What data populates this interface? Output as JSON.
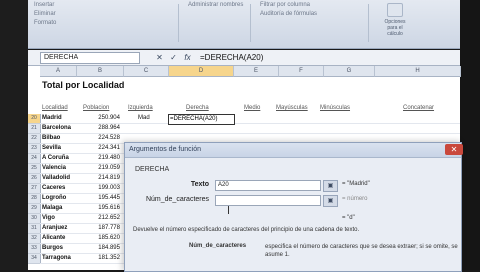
{
  "ribbon": {
    "top_items": [
      "Insertar",
      "Eliminar",
      "Formato"
    ],
    "filter_label": "Filtrar por columna",
    "manage_label": "Administrar nombres",
    "audit_label": "Auditoría de fórmulas",
    "calc_label": "Opciones para el cálculo"
  },
  "formula_bar": {
    "name_box": "DERECHA",
    "cancel_icon": "✕",
    "enter_icon": "✓",
    "fx_icon": "fx",
    "formula": "=DERECHA(A20)"
  },
  "sheet": {
    "columns": [
      "A",
      "B",
      "C",
      "D",
      "E",
      "F",
      "G",
      "H"
    ],
    "title": "Total por Localidad",
    "headers": [
      "Localidad",
      "Poblacion",
      "Izquierda",
      "Derecha",
      "Medio",
      "Mayúsculas",
      "Minúsculas",
      "Concatenar"
    ],
    "rows": [
      {
        "row": "20",
        "loc": "Madrid",
        "pob": "250.904",
        "izq": "Mad",
        "der": "=DERECHA(A20)"
      },
      {
        "row": "21",
        "loc": "Barcelona",
        "pob": "288.964",
        "izq": "",
        "der": ""
      },
      {
        "row": "22",
        "loc": "Bilbao",
        "pob": "224.528",
        "izq": "",
        "der": ""
      },
      {
        "row": "23",
        "loc": "Sevilla",
        "pob": "224.341",
        "izq": "",
        "der": ""
      },
      {
        "row": "24",
        "loc": "A Coruña",
        "pob": "219.480",
        "izq": "",
        "der": ""
      },
      {
        "row": "25",
        "loc": "Valencia",
        "pob": "219.059",
        "izq": "",
        "der": ""
      },
      {
        "row": "26",
        "loc": "Valladolid",
        "pob": "214.819",
        "izq": "",
        "der": ""
      },
      {
        "row": "27",
        "loc": "Caceres",
        "pob": "199.003",
        "izq": "",
        "der": ""
      },
      {
        "row": "28",
        "loc": "Logroño",
        "pob": "195.445",
        "izq": "",
        "der": ""
      },
      {
        "row": "29",
        "loc": "Malaga",
        "pob": "195.616",
        "izq": "",
        "der": ""
      },
      {
        "row": "30",
        "loc": "Vigo",
        "pob": "212.652",
        "izq": "",
        "der": ""
      },
      {
        "row": "31",
        "loc": "Aranjuez",
        "pob": "187.778",
        "izq": "",
        "der": ""
      },
      {
        "row": "32",
        "loc": "Alicante",
        "pob": "185.620",
        "izq": "",
        "der": ""
      },
      {
        "row": "33",
        "loc": "Burgos",
        "pob": "184.895",
        "izq": "",
        "der": ""
      },
      {
        "row": "34",
        "loc": "Tarragona",
        "pob": "181.352",
        "izq": "",
        "der": ""
      }
    ]
  },
  "dialog": {
    "title": "Argumentos de función",
    "close_icon": "✕",
    "function_name": "DERECHA",
    "arg1_label": "Texto",
    "arg1_value": "A20",
    "arg1_result": "= \"Madrid\"",
    "arg2_label": "Núm_de_caracteres",
    "arg2_value": "",
    "arg2_result": "= número",
    "total_result": "= \"d\"",
    "description": "Devuelve el número especificado de caracteres del principio de una cadena de texto.",
    "param_name": "Núm_de_caracteres",
    "param_desc": "especifica el número de caracteres que se desea extraer; si se omite, se asume 1."
  }
}
